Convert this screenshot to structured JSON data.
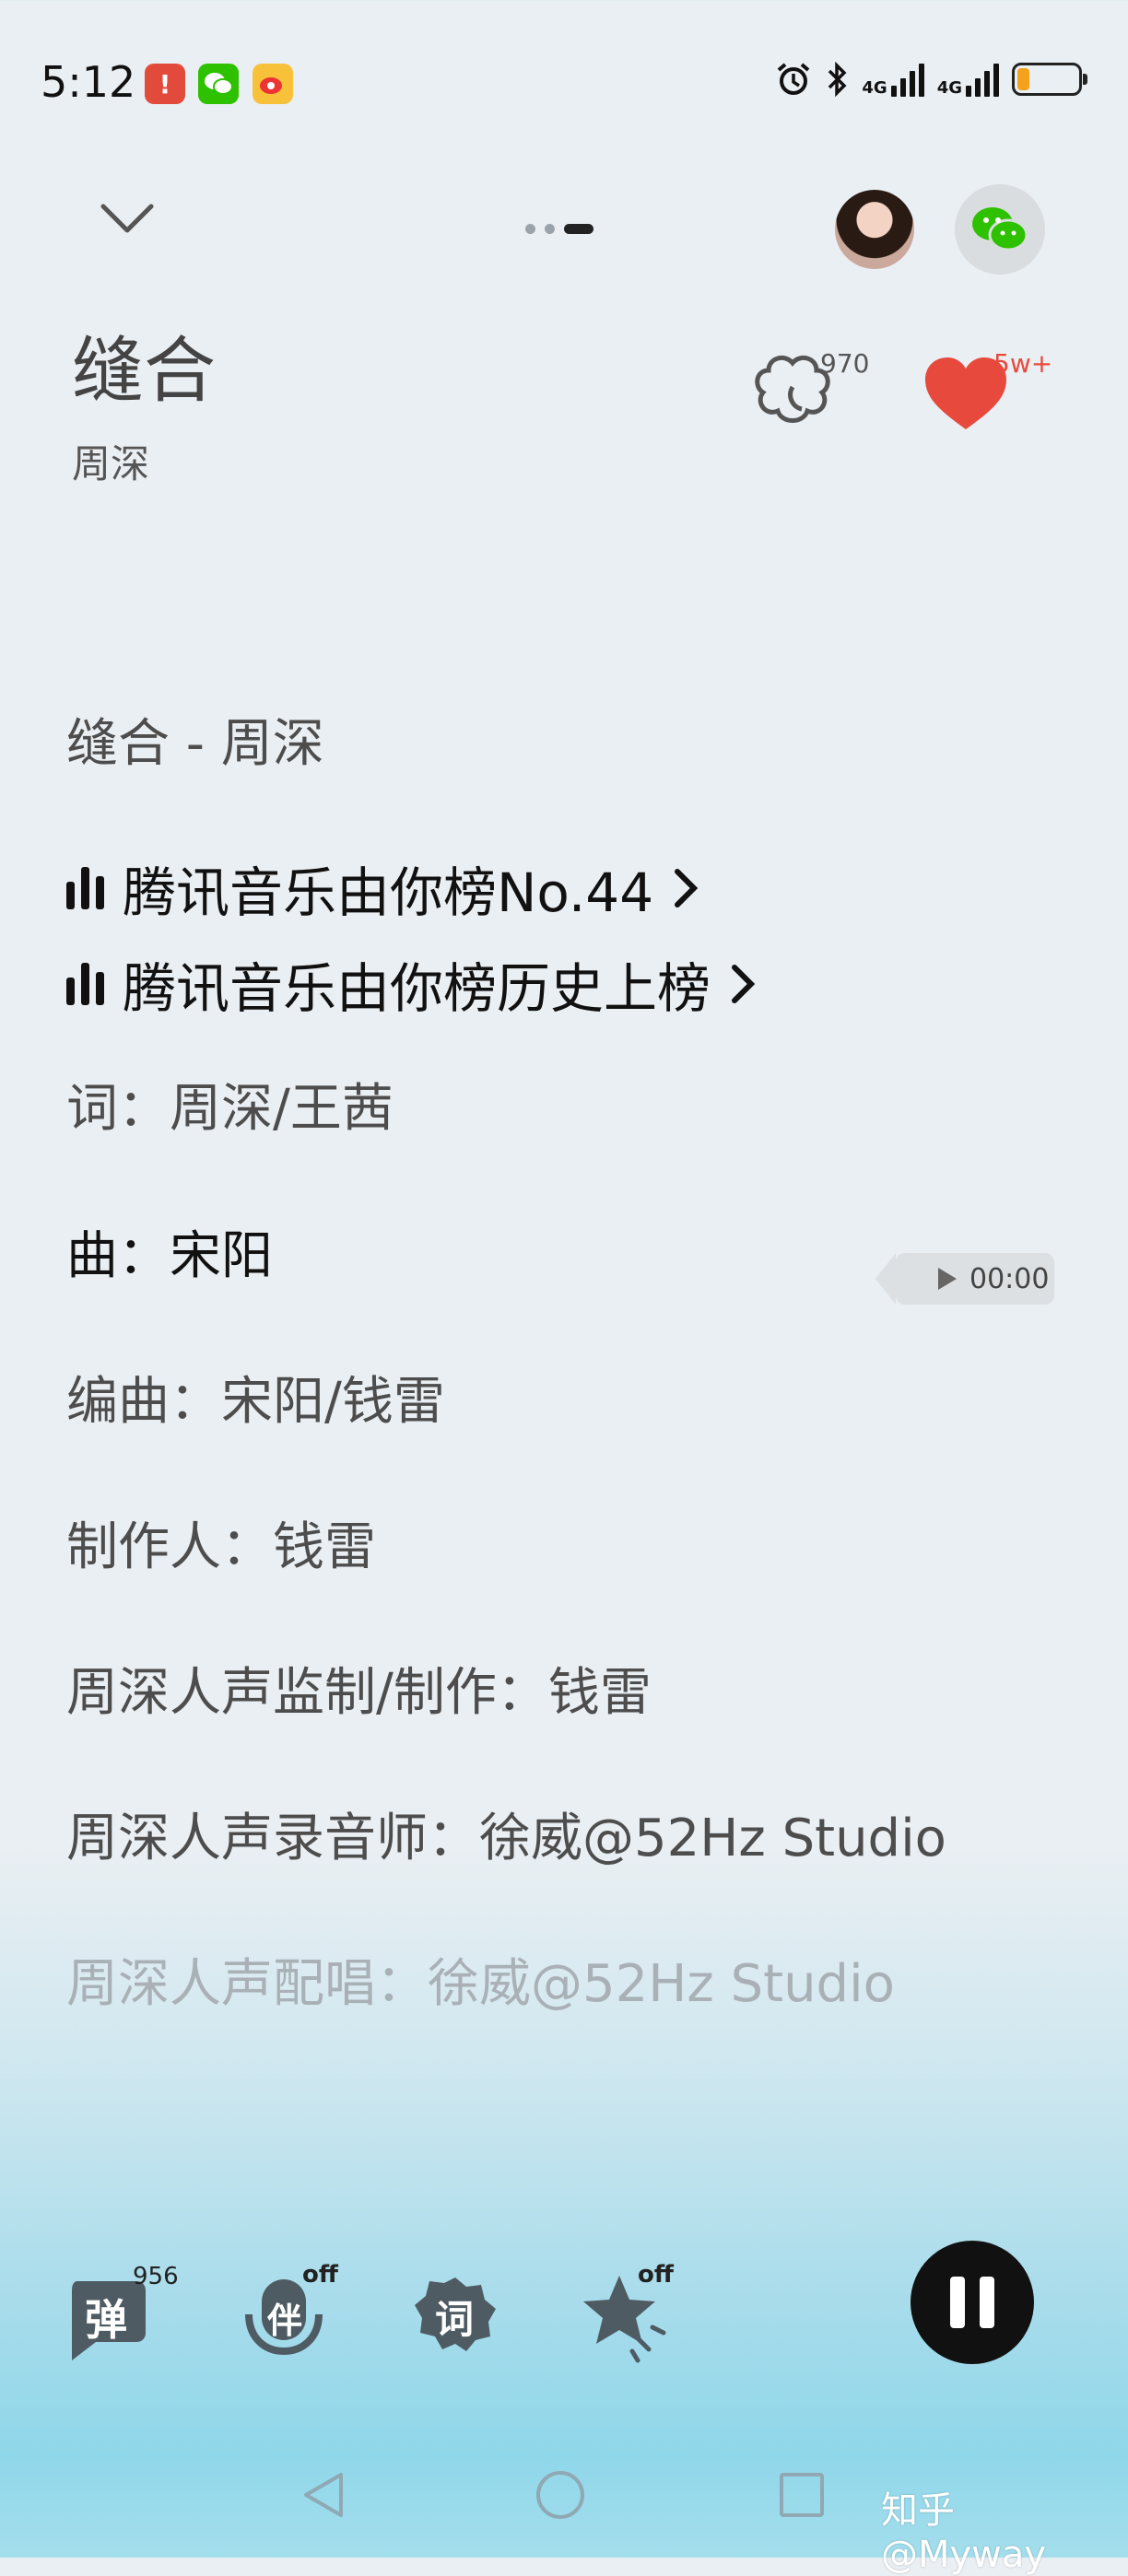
{
  "status_bar": {
    "time": "5:12",
    "network_1": "4G",
    "network_2": "4G",
    "battery_percent": 20
  },
  "header": {
    "song_title": "缝合",
    "artist": "周深",
    "comment_count": "970",
    "like_count": "5w+"
  },
  "lyrics": {
    "title_line": "缝合 - 周深",
    "rank_1": "腾讯音乐由你榜No.44",
    "rank_2": "腾讯音乐由你榜历史上榜",
    "lyricist": "词：周深/王茜",
    "composer": "曲：宋阳",
    "arranger": "编曲：宋阳/钱雷",
    "producer": "制作人：钱雷",
    "vocal_producer": "周深人声监制/制作：钱雷",
    "vocal_engineer": "周深人声录音师：徐威@52Hz Studio",
    "vocal_feat": "周深人声配唱：徐威@52Hz Studio"
  },
  "time_pill": "00:00",
  "tools": {
    "danmaku_label": "弹",
    "danmaku_count": "956",
    "accompany_label": "伴",
    "accompany_state": "off",
    "lyrics_label": "词",
    "effect_state": "off"
  },
  "watermark": "知乎 @Myway",
  "colors": {
    "accent_red": "#e8493d",
    "wechat_green": "#2dc100",
    "tool_gray": "#4f5b63"
  },
  "icons": [
    "collapse-chevron-icon",
    "comment-cloud-icon",
    "heart-icon",
    "wechat-icon",
    "play-triangle-icon",
    "pause-icon",
    "back-triangle-icon",
    "home-circle-icon",
    "recent-square-icon"
  ]
}
